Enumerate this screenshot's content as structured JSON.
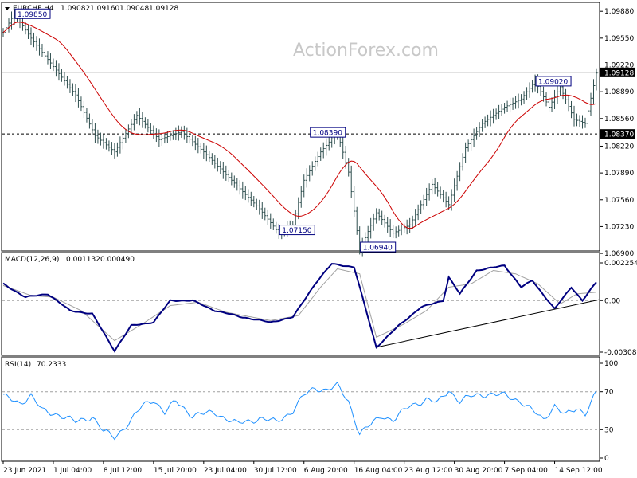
{
  "watermark": "ActionForex.com",
  "colors": {
    "price_bars": "#2f4f4f",
    "ma": "#cc0000",
    "macd": "#000080",
    "signal": "#a0a0a0",
    "rsi": "#1e90ff",
    "trendline": "#000000",
    "label_border": "#000080"
  },
  "price_panel": {
    "symbol": "EURCHF,H4",
    "ohlc": [
      "1.09082",
      "1.09160",
      "1.09048",
      "1.09128"
    ],
    "ylim": [
      1.0694,
      1.0998
    ],
    "yticks": [
      "1.09880",
      "1.09550",
      "1.09220",
      "1.08890",
      "1.08560",
      "1.08220",
      "1.07890",
      "1.07560",
      "1.07230",
      "1.06900"
    ],
    "current_price": "1.09128",
    "support_level": "1.08370",
    "annotations": [
      {
        "text": "1.09850",
        "x": 4,
        "y": 1.0985
      },
      {
        "text": "1.08390",
        "x": 110,
        "y": 1.0839
      },
      {
        "text": "1.07150",
        "x": 99,
        "y": 1.0715
      },
      {
        "text": "1.06940",
        "x": 128,
        "y": 1.0694
      },
      {
        "text": "1.09020",
        "x": 191,
        "y": 1.0902
      }
    ],
    "pivots": [
      [
        0,
        1.0962
      ],
      [
        4,
        1.0985
      ],
      [
        10,
        1.0955
      ],
      [
        18,
        1.092
      ],
      [
        26,
        1.0885
      ],
      [
        33,
        1.0835
      ],
      [
        40,
        1.0815
      ],
      [
        48,
        1.086
      ],
      [
        56,
        1.083
      ],
      [
        64,
        1.084
      ],
      [
        72,
        1.0815
      ],
      [
        82,
        1.078
      ],
      [
        92,
        1.0745
      ],
      [
        99,
        1.0715
      ],
      [
        104,
        1.0725
      ],
      [
        108,
        1.078
      ],
      [
        114,
        1.0815
      ],
      [
        120,
        1.0839
      ],
      [
        124,
        1.079
      ],
      [
        128,
        1.0694
      ],
      [
        134,
        1.074
      ],
      [
        140,
        1.0715
      ],
      [
        146,
        1.0725
      ],
      [
        154,
        1.0775
      ],
      [
        160,
        1.075
      ],
      [
        166,
        1.082
      ],
      [
        172,
        1.085
      ],
      [
        180,
        1.087
      ],
      [
        186,
        1.088
      ],
      [
        191,
        1.0902
      ],
      [
        196,
        1.087
      ],
      [
        200,
        1.0895
      ],
      [
        205,
        1.0855
      ],
      [
        209,
        1.085
      ],
      [
        213,
        1.0912
      ]
    ]
  },
  "macd_panel": {
    "title": "MACD(12,26,9)",
    "values": [
      "0.001132",
      "0.000490"
    ],
    "ylim": [
      -0.003088,
      0.002254
    ],
    "yticks": [
      "0.002254",
      "0.00",
      "-0.003088"
    ],
    "macd_pivots": [
      [
        0,
        0.001
      ],
      [
        8,
        0.0002
      ],
      [
        16,
        0.0004
      ],
      [
        24,
        -0.0006
      ],
      [
        32,
        -0.0008
      ],
      [
        40,
        -0.003
      ],
      [
        46,
        -0.0015
      ],
      [
        54,
        -0.0013
      ],
      [
        60,
        0.0
      ],
      [
        68,
        0.0
      ],
      [
        76,
        -0.0006
      ],
      [
        86,
        -0.001
      ],
      [
        96,
        -0.0013
      ],
      [
        104,
        -0.001
      ],
      [
        112,
        0.001
      ],
      [
        118,
        0.0022
      ],
      [
        126,
        0.002
      ],
      [
        134,
        -0.0028
      ],
      [
        142,
        -0.0015
      ],
      [
        150,
        -0.0004
      ],
      [
        158,
        0.0
      ],
      [
        160,
        0.0014
      ],
      [
        164,
        0.0004
      ],
      [
        170,
        0.0018
      ],
      [
        180,
        0.0021
      ],
      [
        186,
        0.0008
      ],
      [
        190,
        0.0012
      ],
      [
        198,
        -0.0005
      ],
      [
        204,
        0.0008
      ],
      [
        208,
        0.0
      ],
      [
        213,
        0.0011
      ]
    ],
    "signal_pivots": [
      [
        0,
        0.0009
      ],
      [
        10,
        0.0003
      ],
      [
        18,
        0.0002
      ],
      [
        28,
        -0.0006
      ],
      [
        40,
        -0.0024
      ],
      [
        50,
        -0.0014
      ],
      [
        60,
        -0.0003
      ],
      [
        70,
        -0.0001
      ],
      [
        80,
        -0.0007
      ],
      [
        96,
        -0.0012
      ],
      [
        106,
        -0.0009
      ],
      [
        114,
        0.0008
      ],
      [
        120,
        0.0019
      ],
      [
        128,
        0.0016
      ],
      [
        134,
        -0.0022
      ],
      [
        144,
        -0.0014
      ],
      [
        152,
        -0.0006
      ],
      [
        160,
        0.0008
      ],
      [
        168,
        0.001
      ],
      [
        176,
        0.0018
      ],
      [
        184,
        0.0016
      ],
      [
        192,
        0.001
      ],
      [
        200,
        -0.0002
      ],
      [
        206,
        0.0004
      ],
      [
        213,
        0.0005
      ]
    ],
    "trendline": [
      [
        134,
        -0.0028
      ],
      [
        213,
        0.0
      ]
    ]
  },
  "rsi_panel": {
    "title": "RSI(14)",
    "value": "70.2333",
    "ylim": [
      0,
      100
    ],
    "yticks": [
      "100",
      "70",
      "30",
      "0"
    ],
    "levels": [
      70,
      30
    ],
    "pivots": [
      [
        0,
        65
      ],
      [
        6,
        58
      ],
      [
        10,
        66
      ],
      [
        14,
        50
      ],
      [
        20,
        46
      ],
      [
        26,
        38
      ],
      [
        32,
        44
      ],
      [
        36,
        28
      ],
      [
        40,
        22
      ],
      [
        46,
        40
      ],
      [
        50,
        55
      ],
      [
        54,
        62
      ],
      [
        58,
        48
      ],
      [
        62,
        60
      ],
      [
        68,
        45
      ],
      [
        76,
        48
      ],
      [
        84,
        36
      ],
      [
        92,
        42
      ],
      [
        98,
        38
      ],
      [
        104,
        50
      ],
      [
        108,
        66
      ],
      [
        112,
        74
      ],
      [
        116,
        72
      ],
      [
        120,
        76
      ],
      [
        124,
        60
      ],
      [
        128,
        26
      ],
      [
        132,
        35
      ],
      [
        136,
        45
      ],
      [
        140,
        40
      ],
      [
        146,
        55
      ],
      [
        152,
        62
      ],
      [
        156,
        58
      ],
      [
        160,
        72
      ],
      [
        164,
        60
      ],
      [
        168,
        65
      ],
      [
        174,
        68
      ],
      [
        180,
        66
      ],
      [
        186,
        60
      ],
      [
        190,
        50
      ],
      [
        194,
        40
      ],
      [
        198,
        56
      ],
      [
        202,
        45
      ],
      [
        206,
        52
      ],
      [
        209,
        48
      ],
      [
        213,
        70
      ]
    ]
  },
  "x_axis": {
    "count": 214,
    "labels": [
      {
        "text": "23 Jun 2021",
        "i": 0
      },
      {
        "text": "1 Jul 04:00",
        "i": 18
      },
      {
        "text": "8 Jul 12:00",
        "i": 36
      },
      {
        "text": "15 Jul 20:00",
        "i": 54
      },
      {
        "text": "23 Jul 04:00",
        "i": 72
      },
      {
        "text": "30 Jul 12:00",
        "i": 90
      },
      {
        "text": "6 Aug 20:00",
        "i": 108
      },
      {
        "text": "16 Aug 04:00",
        "i": 126
      },
      {
        "text": "23 Aug 12:00",
        "i": 144
      },
      {
        "text": "30 Aug 20:00",
        "i": 162
      },
      {
        "text": "7 Sep 04:00",
        "i": 180
      },
      {
        "text": "14 Sep 12:00",
        "i": 198
      }
    ]
  }
}
